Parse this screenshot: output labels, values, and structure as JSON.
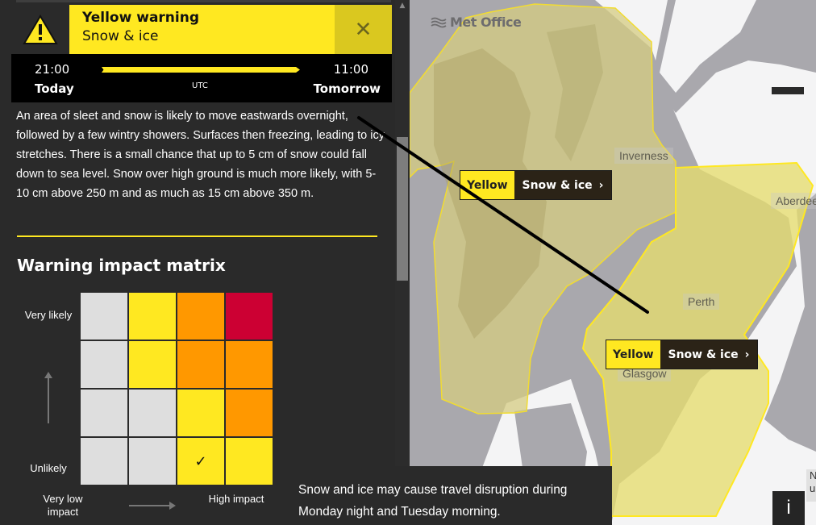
{
  "warning": {
    "level": "Yellow warning",
    "type": "Snow & ice",
    "close_icon": "close-icon",
    "alert_icon": "warning-triangle-icon",
    "accent_color": "#ffe821",
    "close_bg_color": "#dac81f"
  },
  "timeline": {
    "start_time": "21:00",
    "start_day": "Today",
    "end_time": "11:00",
    "end_day": "Tomorrow",
    "timezone": "UTC"
  },
  "description": "An area of sleet and snow is likely to move eastwards overnight, followed by a few wintry showers. Surfaces then freezing, leading to icy stretches. There is a small chance that up to 5 cm of snow could fall down to sea level. Snow over high ground is much more likely, with 5-10 cm above 250 m and as much as 15 cm above 350 m.",
  "matrix": {
    "title": "Warning impact matrix",
    "y_high_label": "Very likely",
    "y_low_label": "Unlikely",
    "x_low_label": "Very low impact",
    "x_high_label": "High impact",
    "rows": [
      [
        "grey",
        "yellow",
        "amber",
        "red"
      ],
      [
        "grey",
        "yellow",
        "amber",
        "amber"
      ],
      [
        "grey",
        "grey",
        "yellow",
        "amber"
      ],
      [
        "grey",
        "grey",
        "yellow",
        "yellow"
      ]
    ],
    "selected": {
      "row": 3,
      "col": 2
    },
    "check_mark": "✓",
    "colors": {
      "grey": "#dedede",
      "yellow": "#ffe821",
      "amber": "#ff9800",
      "red": "#cc0033"
    }
  },
  "impact_text": "Snow and ice may cause travel disruption during Monday night and Tuesday morning.",
  "map": {
    "logo_text": "Met Office",
    "cities": [
      "Inverness",
      "Aberdeen",
      "Perth",
      "Glasgow"
    ],
    "pills": [
      {
        "level": "Yellow",
        "type": "Snow & ice"
      },
      {
        "level": "Yellow",
        "type": "Snow & ice"
      }
    ],
    "info_label": "i",
    "edge_label": "N u"
  }
}
